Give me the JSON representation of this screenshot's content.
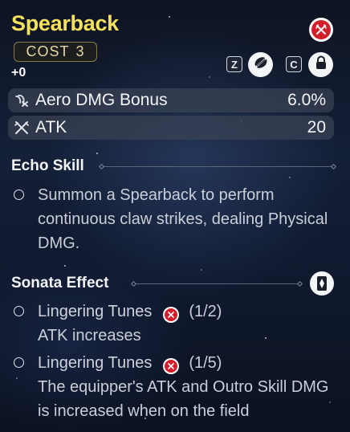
{
  "header": {
    "title": "Spearback",
    "cost_label": "COST",
    "cost_value": "3",
    "level": "+0",
    "key_discard": "Z",
    "key_lock": "C"
  },
  "stats": [
    {
      "icon": "aero-dmg-icon",
      "name": "Aero DMG Bonus",
      "value": "6.0%"
    },
    {
      "icon": "atk-icon",
      "name": "ATK",
      "value": "20"
    }
  ],
  "echo_skill": {
    "heading": "Echo Skill",
    "description": "Summon a Spearback to perform continuous claw strikes, dealing Physical DMG."
  },
  "sonata": {
    "heading": "Sonata Effect",
    "effects": [
      {
        "name": "Lingering Tunes",
        "count": "(1/2)",
        "description": "ATK increases"
      },
      {
        "name": "Lingering Tunes",
        "count": "(1/5)",
        "description": "The equipper's ATK and Outro Skill DMG is increased when on the field"
      }
    ]
  },
  "colors": {
    "title": "#f6e15d",
    "sonata_badge": "#d21f2a",
    "stat_bar": "#3a4254"
  }
}
